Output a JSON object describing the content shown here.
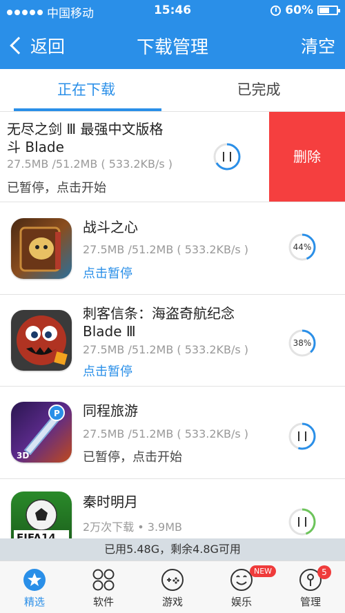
{
  "status_bar": {
    "carrier": "中国移动",
    "time": "15:46",
    "battery": "60%",
    "battery_level": 0.6
  },
  "nav": {
    "back_label": "返回",
    "title": "下载管理",
    "clear_label": "清空"
  },
  "tabs": [
    {
      "label": "正在下载",
      "active": true
    },
    {
      "label": "已完成",
      "active": false
    }
  ],
  "downloads": [
    {
      "title_line1": "无尽之剑 Ⅲ 最强中文版格",
      "title_line2": "斗 Blade",
      "meta": "27.5MB /51.2MB ( 533.2KB/s )",
      "status": "已暂停，点击开始",
      "progress": null,
      "delete_label": "删除"
    },
    {
      "title_line1": "战斗之心",
      "meta": "27.5MB /51.2MB ( 533.2KB/s )",
      "status": "点击暂停",
      "progress": 0.44,
      "progress_label": "44%"
    },
    {
      "title_line1": "刺客信条：海盗奇航纪念",
      "title_line2": "Blade Ⅲ",
      "meta": "27.5MB /51.2MB ( 533.2KB/s )",
      "status": "点击暂停",
      "progress": 0.38,
      "progress_label": "38%"
    },
    {
      "title_line1": "同程旅游",
      "meta": "27.5MB /51.2MB ( 533.2KB/s )",
      "status": "已暂停，点击开始",
      "progress": 0.55
    },
    {
      "title_line1": "秦时明月",
      "meta": "2万次下载 • 3.9MB",
      "progress": 0.45
    }
  ],
  "storage": "已用5.48G，剩余4.8G可用",
  "bottom_tabs": [
    {
      "label": "精选",
      "active": true
    },
    {
      "label": "软件"
    },
    {
      "label": "游戏"
    },
    {
      "label": "娱乐",
      "badge": "NEW"
    },
    {
      "label": "管理",
      "badge": "5"
    }
  ],
  "icon_texts": {
    "fifa": "FIFA14",
    "three_d": "3D"
  },
  "colors": {
    "brand_blue": "#2a8fe8",
    "delete_red": "#f53f3f",
    "ring_green": "#6cc45a"
  }
}
